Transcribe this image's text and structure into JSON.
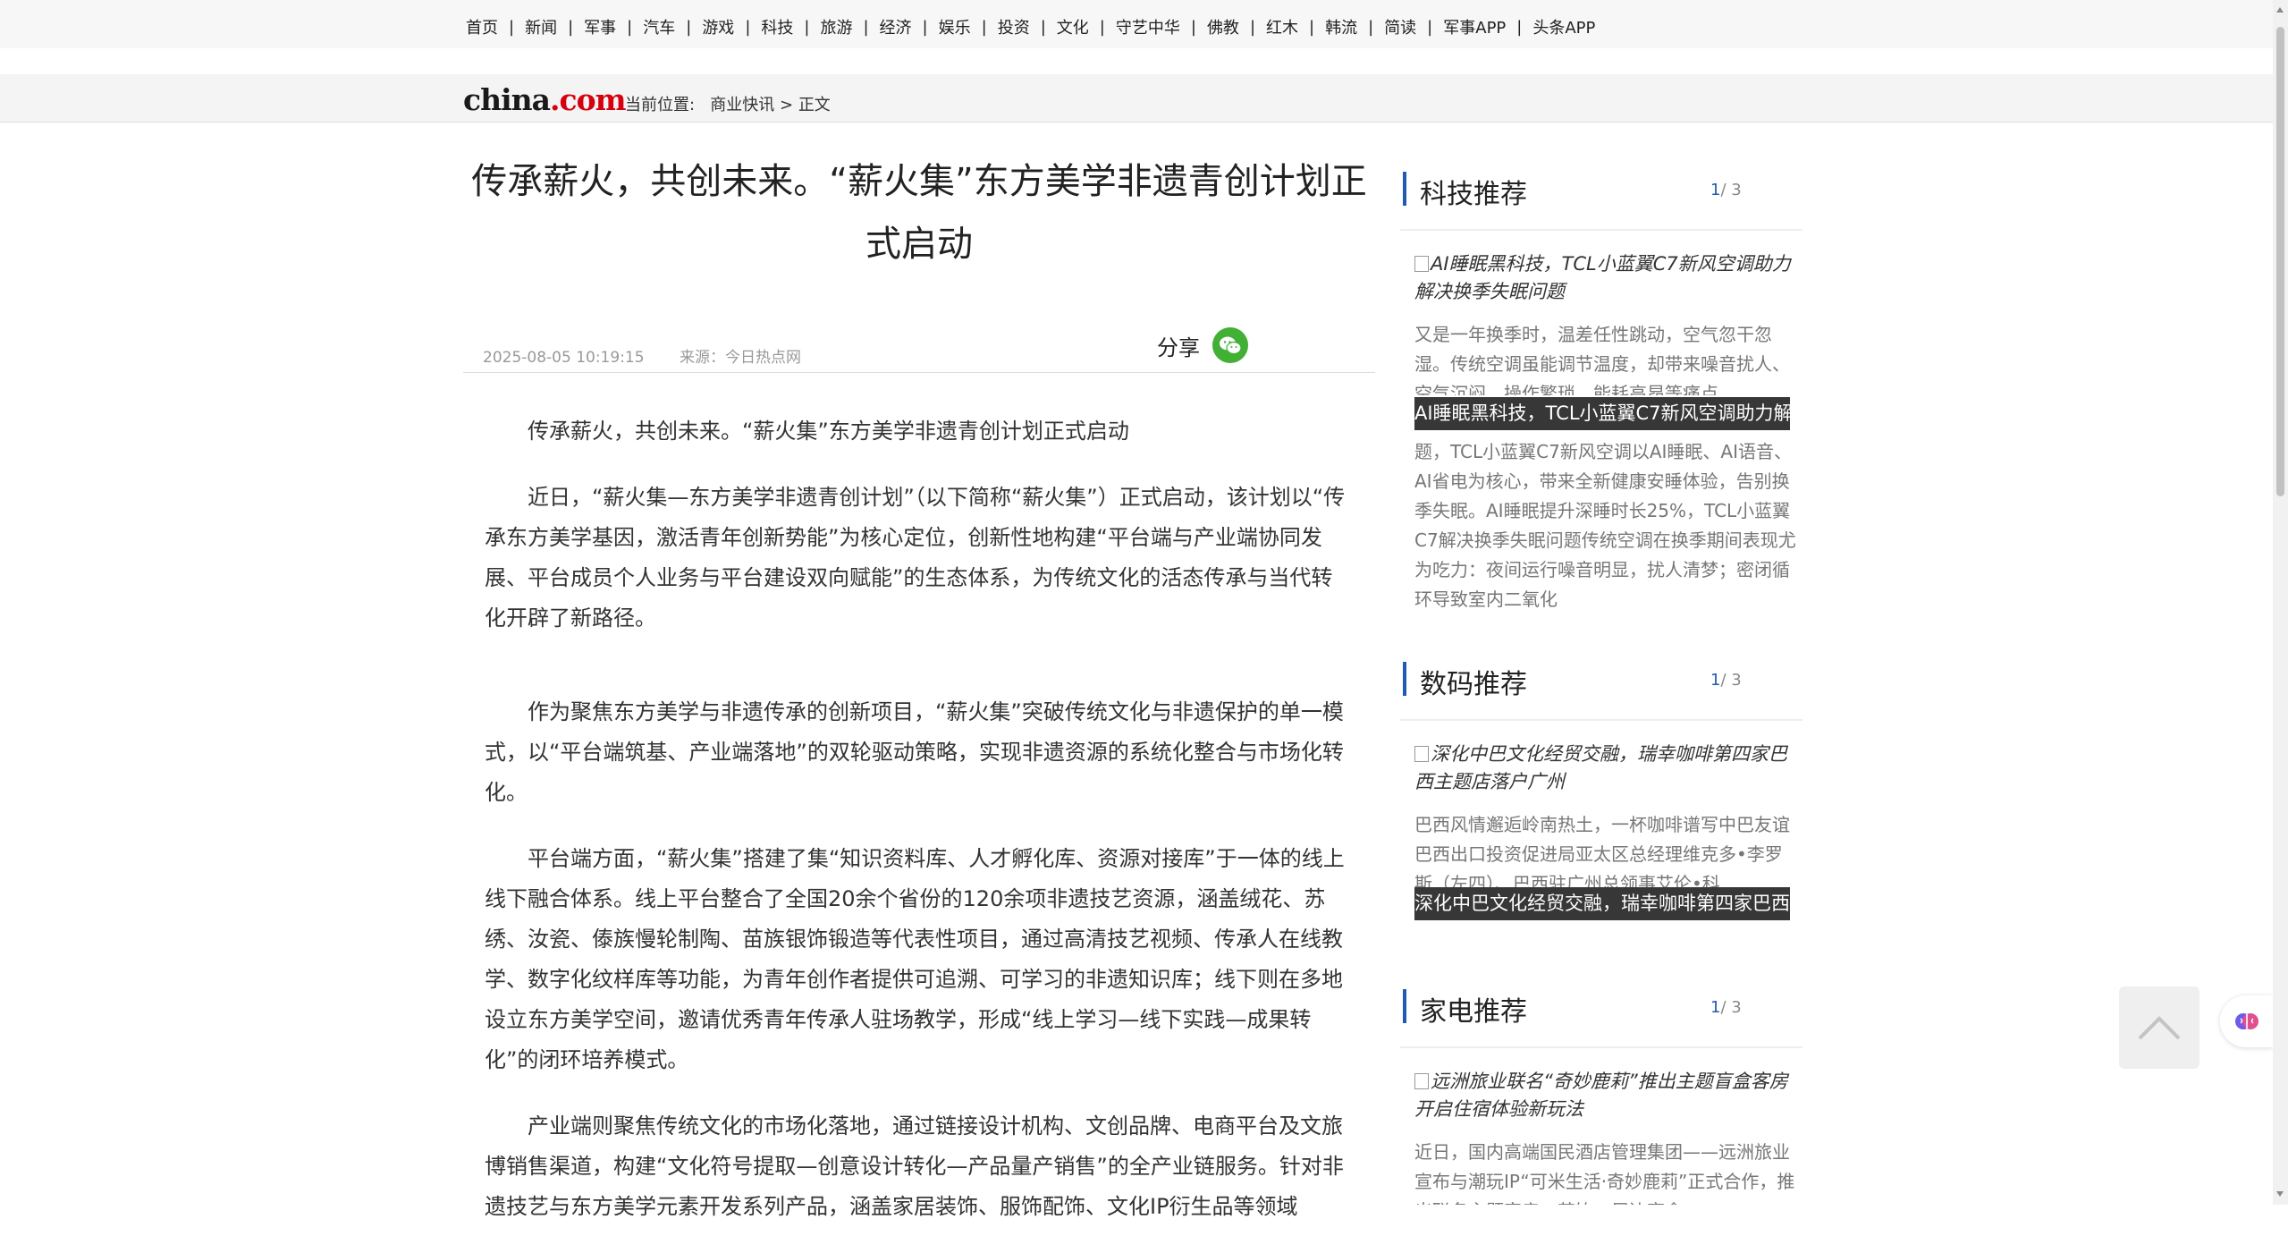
{
  "nav": {
    "items": [
      "首页",
      "新闻",
      "军事",
      "汽车",
      "游戏",
      "科技",
      "旅游",
      "经济",
      "娱乐",
      "投资",
      "文化",
      "守艺中华",
      "佛教",
      "红木",
      "韩流",
      "简读",
      "军事APP",
      "头条APP"
    ],
    "separator": "|"
  },
  "logo": {
    "main": "china",
    "suffix": ".com",
    "accent": "#d7000f"
  },
  "breadcrumb": {
    "label": "当前位置:",
    "category": "商业快讯",
    "arrow": ">",
    "current": "正文"
  },
  "article": {
    "title": "传承薪火，共创未来。“薪火集”东方美学非遗青创计划正式启动",
    "date": "2025-08-05 10:19:15",
    "source": "来源：今日热点网",
    "share_label": "分享",
    "paragraphs": [
      "传承薪火，共创未来。“薪火集”东方美学非遗青创计划正式启动",
      "近日，“薪火集—东方美学非遗青创计划”（以下简称“薪火集”）正式启动，该计划以“传承东方美学基因，激活青年创新势能”为核心定位，创新性地构建“平台端与产业端协同发展、平台成员个人业务与平台建设双向赋能”的生态体系，为传统文化的活态传承与当代转化开辟了新路径。",
      "作为聚焦东方美学与非遗传承的创新项目，“薪火集”突破传统文化与非遗保护的单一模式，以“平台端筑基、产业端落地”的双轮驱动策略，实现非遗资源的系统化整合与市场化转化。",
      "平台端方面，“薪火集”搭建了集“知识资料库、人才孵化库、资源对接库”于一体的线上线下融合体系。线上平台整合了全国20余个省份的120余项非遗技艺资源，涵盖绒花、苏绣、汝瓷、傣族慢轮制陶、苗族银饰锻造等代表性项目，通过高清技艺视频、传承人在线教学、数字化纹样库等功能，为青年创作者提供可追溯、可学习的非遗知识库；线下则在多地设立东方美学空间，邀请优秀青年传承人驻场教学，形成“线上学习—线下实践—成果转化”的闭环培养模式。",
      "产业端则聚焦传统文化的市场化落地，通过链接设计机构、文创品牌、电商平台及文旅博销售渠道，构建“文化符号提取—创意设计转化—产品量产销售”的全产业链服务。针对非遗技艺与东方美学元素开发系列产品，涵盖家居装饰、服饰配饰、文化IP衍生品等领域"
    ]
  },
  "sidebar": {
    "sections": [
      {
        "heading": "科技推荐",
        "page_current": "1",
        "page_total": "/ 3",
        "image_alt": "AI睡眠黑科技，TCL小蓝翼C7新风空调助力解决换季失眠问题",
        "desc": "又是一年换季时，温差任性跳动，空气忽干忽湿。传统空调虽能调节温度，却带来噪音扰人、空气沉闷、操作繁琐、能耗高昂等痛点",
        "overlay": "AI睡眠黑科技，TCL小蓝翼C7新风空调助力解",
        "desc_after": "题，TCL小蓝翼C7新风空调以AI睡眠、AI语音、AI省电为核心，带来全新健康安睡体验，告别换季失眠。AI睡眠提升深睡时长25%，TCL小蓝翼C7解决换季失眠问题传统空调在换季期间表现尤为吃力：夜间运行噪音明显，扰人清梦；密闭循环导致室内二氧化"
      },
      {
        "heading": "数码推荐",
        "page_current": "1",
        "page_total": "/ 3",
        "image_alt": "深化中巴文化经贸交融，瑞幸咖啡第四家巴西主题店落户广州",
        "desc": "巴西风情邂逅岭南热土，一杯咖啡谱写中巴友谊巴西出口投资促进局亚太区总经理维克多•李罗斯（左四）、巴西驻广州总领事艾伦•科",
        "overlay": "深化中巴文化经贸交融，瑞幸咖啡第四家巴西"
      },
      {
        "heading": "家电推荐",
        "page_current": "1",
        "page_total": "/ 3",
        "image_alt": "远洲旅业联名“奇妙鹿莉”推出主题盲盒客房 开启住宿体验新玩法",
        "desc": "近日，国内高端国民酒店管理集团——远洲旅业宣布与潮玩IP“可米生活·奇妙鹿莉”正式合作，推出联名主题客房、茶饮、周边盲盒"
      }
    ]
  },
  "icons": {
    "share": "wechat-icon",
    "totop": "chevron-up-icon",
    "assistant": "brain-icon"
  },
  "colors": {
    "wechat": "#41b035",
    "accent_blue": "#1f5bb3"
  }
}
